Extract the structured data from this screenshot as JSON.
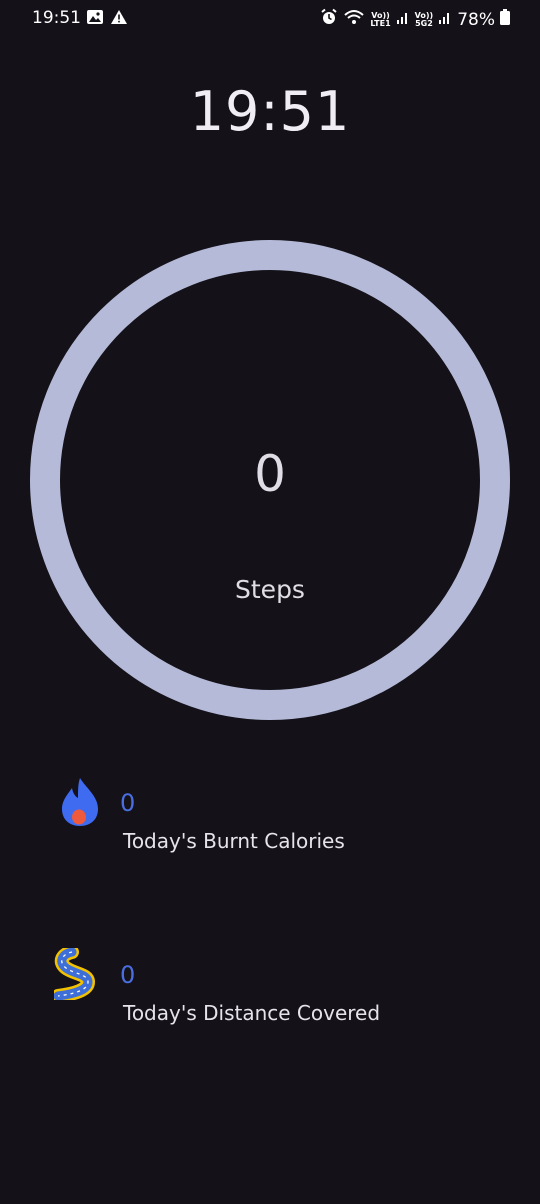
{
  "status_bar": {
    "time": "19:51",
    "volte_1_top": "Vo))",
    "volte_1_bottom": "LTE1",
    "volte_2_top": "Vo))",
    "volte_2_bottom": "5G2",
    "battery": "78%"
  },
  "clock": {
    "time": "19:51"
  },
  "steps": {
    "count": "0",
    "label": "Steps"
  },
  "calories": {
    "value": "0",
    "label": "Today's Burnt Calories"
  },
  "distance": {
    "value": "0",
    "label": "Today's Distance Covered"
  },
  "colors": {
    "background": "#141218",
    "ring": "#b5bad9",
    "value_accent": "#4a6ee0",
    "flame": "#3f6bf0",
    "flame_core": "#f05a3c"
  }
}
